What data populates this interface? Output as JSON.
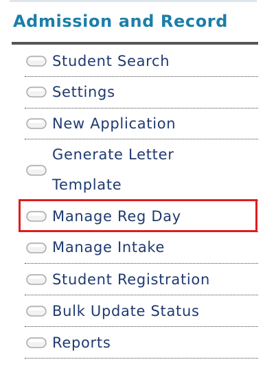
{
  "section": {
    "title": "Admission and Record"
  },
  "menu": {
    "items": [
      {
        "label": "Student Search"
      },
      {
        "label": "Settings"
      },
      {
        "label": "New Application"
      },
      {
        "label_line1": "Generate Letter",
        "label_line2": "Template"
      },
      {
        "label": "Manage Reg Day",
        "highlighted": true
      },
      {
        "label": "Manage Intake"
      },
      {
        "label": "Student Registration"
      },
      {
        "label": "Bulk Update Status"
      },
      {
        "label": "Reports"
      }
    ]
  },
  "colors": {
    "title": "#1a7fa8",
    "item_text": "#1f3a70",
    "highlight_border": "#e01b1b",
    "rule": "#555555"
  },
  "icons": {
    "bullet": "pill-bullet-icon"
  }
}
